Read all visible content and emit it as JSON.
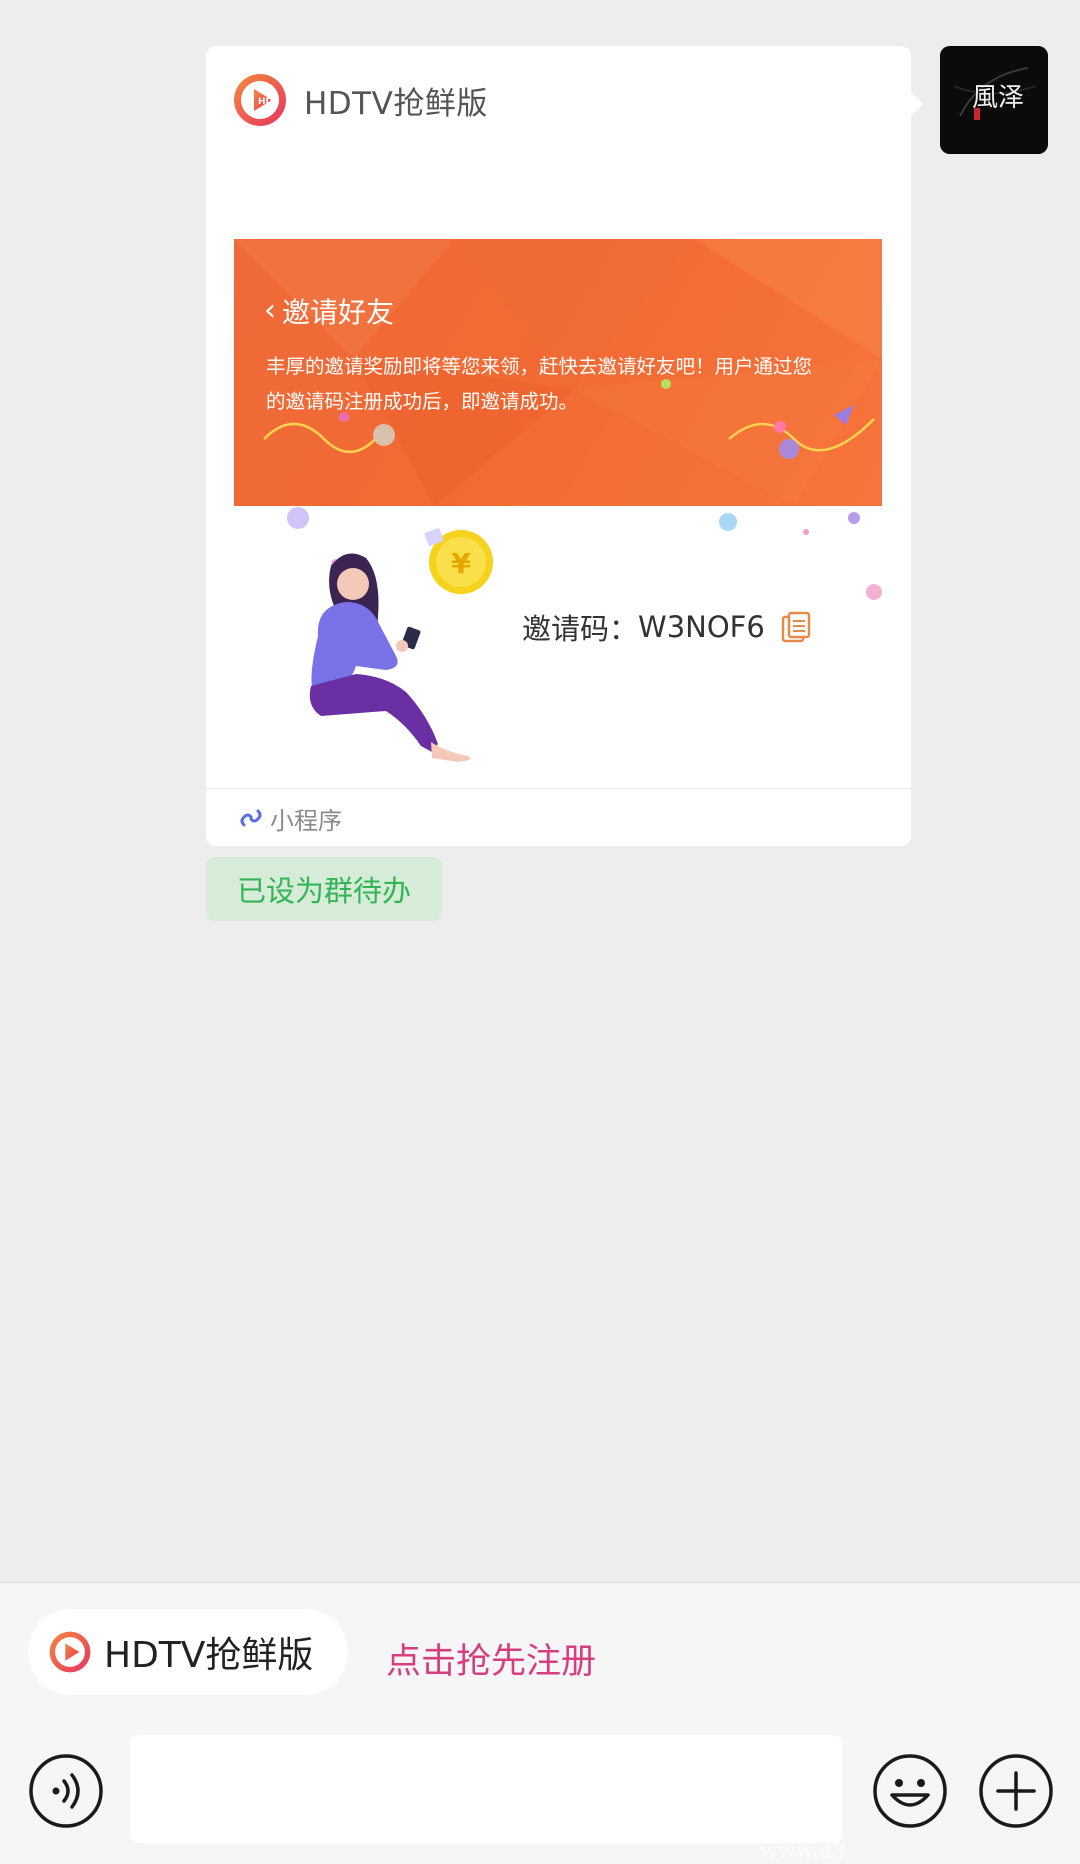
{
  "card": {
    "app_name": "HDTV抢鲜版",
    "banner_title": "邀请好友",
    "banner_desc": "丰厚的邀请奖励即将等您来领，赶快去邀请好友吧！用户通过您的邀请码注册成功后，即邀请成功。",
    "invite_label": "邀请码：",
    "invite_code": "W3NOF6",
    "coin_symbol": "¥",
    "footer_label": "小程序"
  },
  "todo_badge": "已设为群待办",
  "avatar": {
    "text": "風泽"
  },
  "bottom": {
    "chip_label": "HDTV抢鲜版",
    "register_link": "点击抢先注册",
    "input_value": ""
  },
  "watermark": "www.d3",
  "colors": {
    "banner": "#f26a33",
    "todo_bg": "#d6ecd9",
    "todo_text": "#33b556",
    "register_link": "#d63e80",
    "logo_accent": "#ef3e5c"
  }
}
